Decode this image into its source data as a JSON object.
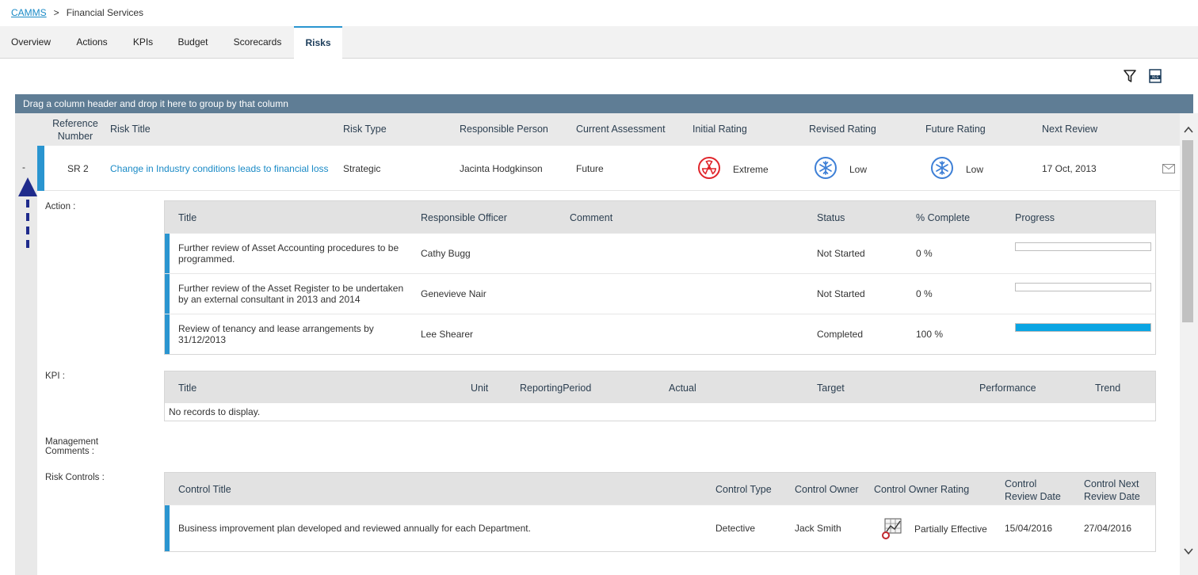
{
  "breadcrumb": {
    "root": "CAMMS",
    "separator": ">",
    "current": "Financial Services"
  },
  "tabs": [
    {
      "label": "Overview"
    },
    {
      "label": "Actions"
    },
    {
      "label": "KPIs"
    },
    {
      "label": "Budget"
    },
    {
      "label": "Scorecards"
    },
    {
      "label": "Risks",
      "active": true
    }
  ],
  "toolbar": {
    "filter_icon": "filter-icon",
    "export_icon": "excel-export-icon"
  },
  "group_panel": {
    "text": "Drag a column header and drop it here to group by that column"
  },
  "grid": {
    "columns": {
      "ref_line1": "Reference",
      "ref_line2": "Number",
      "title": "Risk Title",
      "type": "Risk Type",
      "person": "Responsible Person",
      "assessment": "Current Assessment",
      "initial": "Initial Rating",
      "revised": "Revised Rating",
      "future": "Future Rating",
      "next_review": "Next Review"
    },
    "row": {
      "toggle": "-",
      "ref": "SR 2",
      "title": "Change in Industry conditions leads to financial loss",
      "type": "Strategic",
      "person": "Jacinta Hodgkinson",
      "assessment": "Future",
      "initial": "Extreme",
      "revised": "Low",
      "future": "Low",
      "next_review": "17 Oct, 2013",
      "initial_icon": "extreme-rating-icon",
      "revised_icon": "low-rating-icon",
      "future_icon": "low-rating-icon",
      "mail_icon": "mail-icon"
    }
  },
  "detail": {
    "action_label": "Action :",
    "kpi_label": "KPI :",
    "mgmt_label_line1": "Management",
    "mgmt_label_line2": "Comments :",
    "controls_label": "Risk Controls :",
    "actions": {
      "headers": {
        "title": "Title",
        "officer": "Responsible Officer",
        "comment": "Comment",
        "status": "Status",
        "complete": "% Complete",
        "progress": "Progress"
      },
      "rows": [
        {
          "title_line1": "Further review of Asset Accounting procedures to be",
          "title_line2": "programmed.",
          "officer": "Cathy Bugg",
          "comment": "",
          "status": "Not Started",
          "complete": "0 %",
          "progress": 0
        },
        {
          "title_line1": "Further review of the Asset Register to be undertaken",
          "title_line2": "by an external consultant in 2013 and 2014",
          "officer": "Genevieve Nair",
          "comment": "",
          "status": "Not Started",
          "complete": "0 %",
          "progress": 0
        },
        {
          "title_line1": "Review of tenancy and lease arrangements by",
          "title_line2": "31/12/2013",
          "officer": "Lee Shearer",
          "comment": "",
          "status": "Completed",
          "complete": "100 %",
          "progress": 1
        }
      ]
    },
    "kpis": {
      "headers": {
        "title": "Title",
        "unit": "Unit",
        "period": "ReportingPeriod",
        "actual": "Actual",
        "target": "Target",
        "performance": "Performance",
        "trend": "Trend"
      },
      "empty": "No records to display."
    },
    "controls": {
      "headers": {
        "title": "Control Title",
        "type": "Control Type",
        "owner": "Control Owner",
        "owner_rating": "Control Owner Rating",
        "review_line1": "Control",
        "review_line2": "Review Date",
        "next_line1": "Control Next",
        "next_line2": "Review Date"
      },
      "rows": [
        {
          "title": "Business improvement plan developed and reviewed annually for each Department.",
          "type": "Detective",
          "owner": "Jack Smith",
          "rating": "Partially Effective",
          "rating_icon": "partially-effective-icon",
          "review": "15/04/2016",
          "next": "27/04/2016"
        }
      ]
    }
  },
  "colors": {
    "accent": "#2a95d0",
    "group_panel": "#5f7d95",
    "progress_fill": "#0aa5e3",
    "extreme": "#e0252b",
    "low": "#3d7fd6",
    "annotation": "#1f2b8c"
  }
}
